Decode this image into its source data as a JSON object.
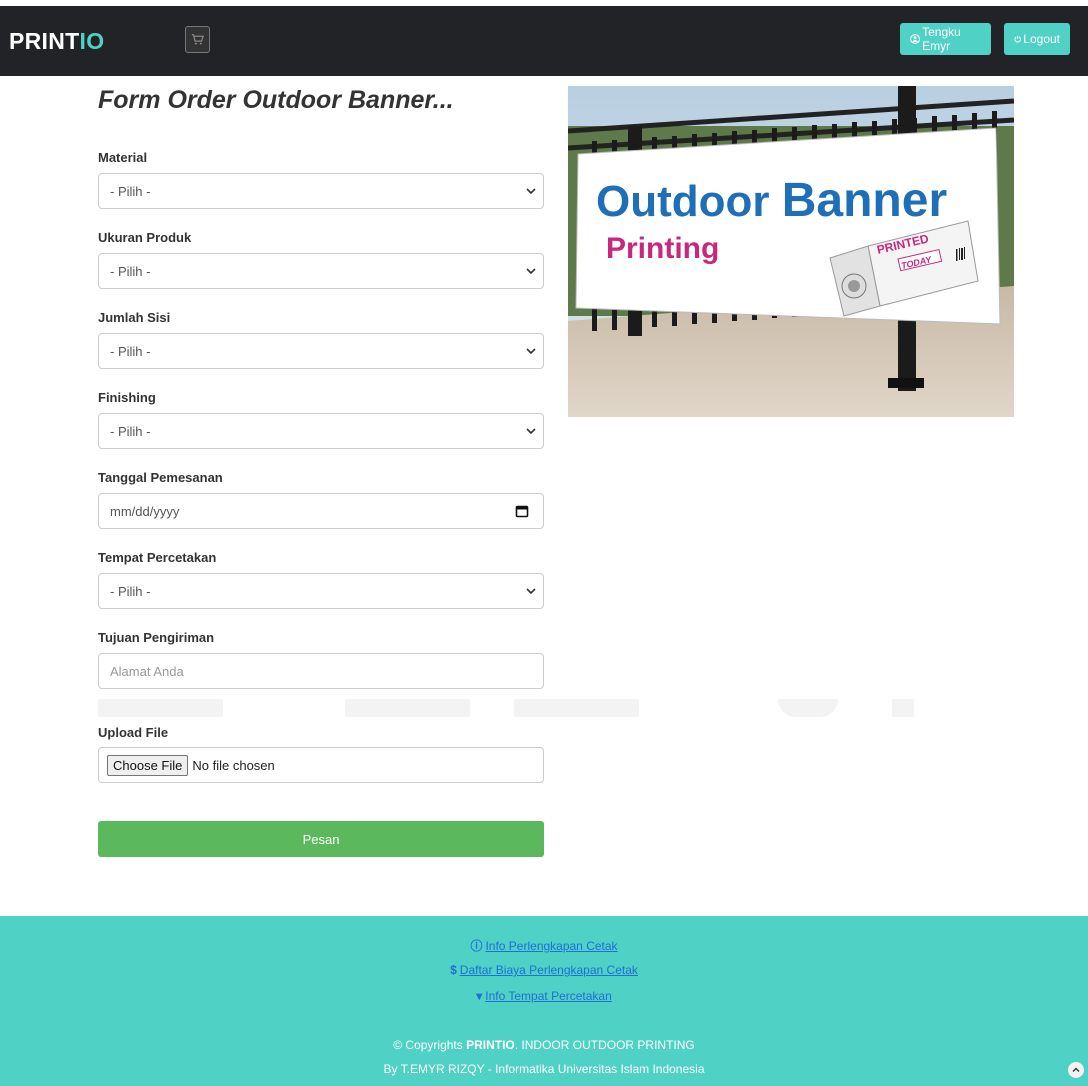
{
  "navbar": {
    "brand_part1": "PRINT",
    "brand_part2": "IO",
    "user_label": "Tengku Emyr",
    "logout_label": "Logout"
  },
  "form": {
    "title": "Form Order Outdoor Banner...",
    "fields": [
      {
        "label": "Material",
        "value": "- Pilih -"
      },
      {
        "label": "Ukuran Produk",
        "value": "- Pilih -"
      },
      {
        "label": "Jumlah Sisi",
        "value": "- Pilih -"
      },
      {
        "label": "Finishing",
        "value": "- Pilih -"
      },
      {
        "label": "Tanggal Pemesanan",
        "value": "mm/dd/yyyy"
      },
      {
        "label": "Tempat Percetakan",
        "value": "- Pilih -"
      },
      {
        "label": "Tujuan Pengiriman",
        "placeholder": "Alamat Anda"
      },
      {
        "label": "Upload File",
        "button": "Choose File",
        "status": "No file chosen"
      }
    ],
    "submit_label": "Pesan"
  },
  "banner": {
    "line1a": "Outdoor",
    "line1b": "Banner",
    "line2": "Printing",
    "box_text1": "PRINTED",
    "box_text2": "TODAY"
  },
  "footer": {
    "link1": "Info Perlengkapan Cetak",
    "link2": "Daftar Biaya Perlengkapan Cetak",
    "link3": "Info Tempat Percetakan",
    "copy_prefix": "© Copyrights ",
    "copy_brand": "PRINTIO",
    "copy_suffix": ". INDOOR OUTDOOR PRINTING",
    "credit": "By T.EMYR RIZQY - Informatika Universitas Islam Indonesia"
  },
  "colors": {
    "navbar": "#222326",
    "accent": "#4fd1c5",
    "submit": "#5cb85c",
    "link": "#1e6fd6"
  }
}
